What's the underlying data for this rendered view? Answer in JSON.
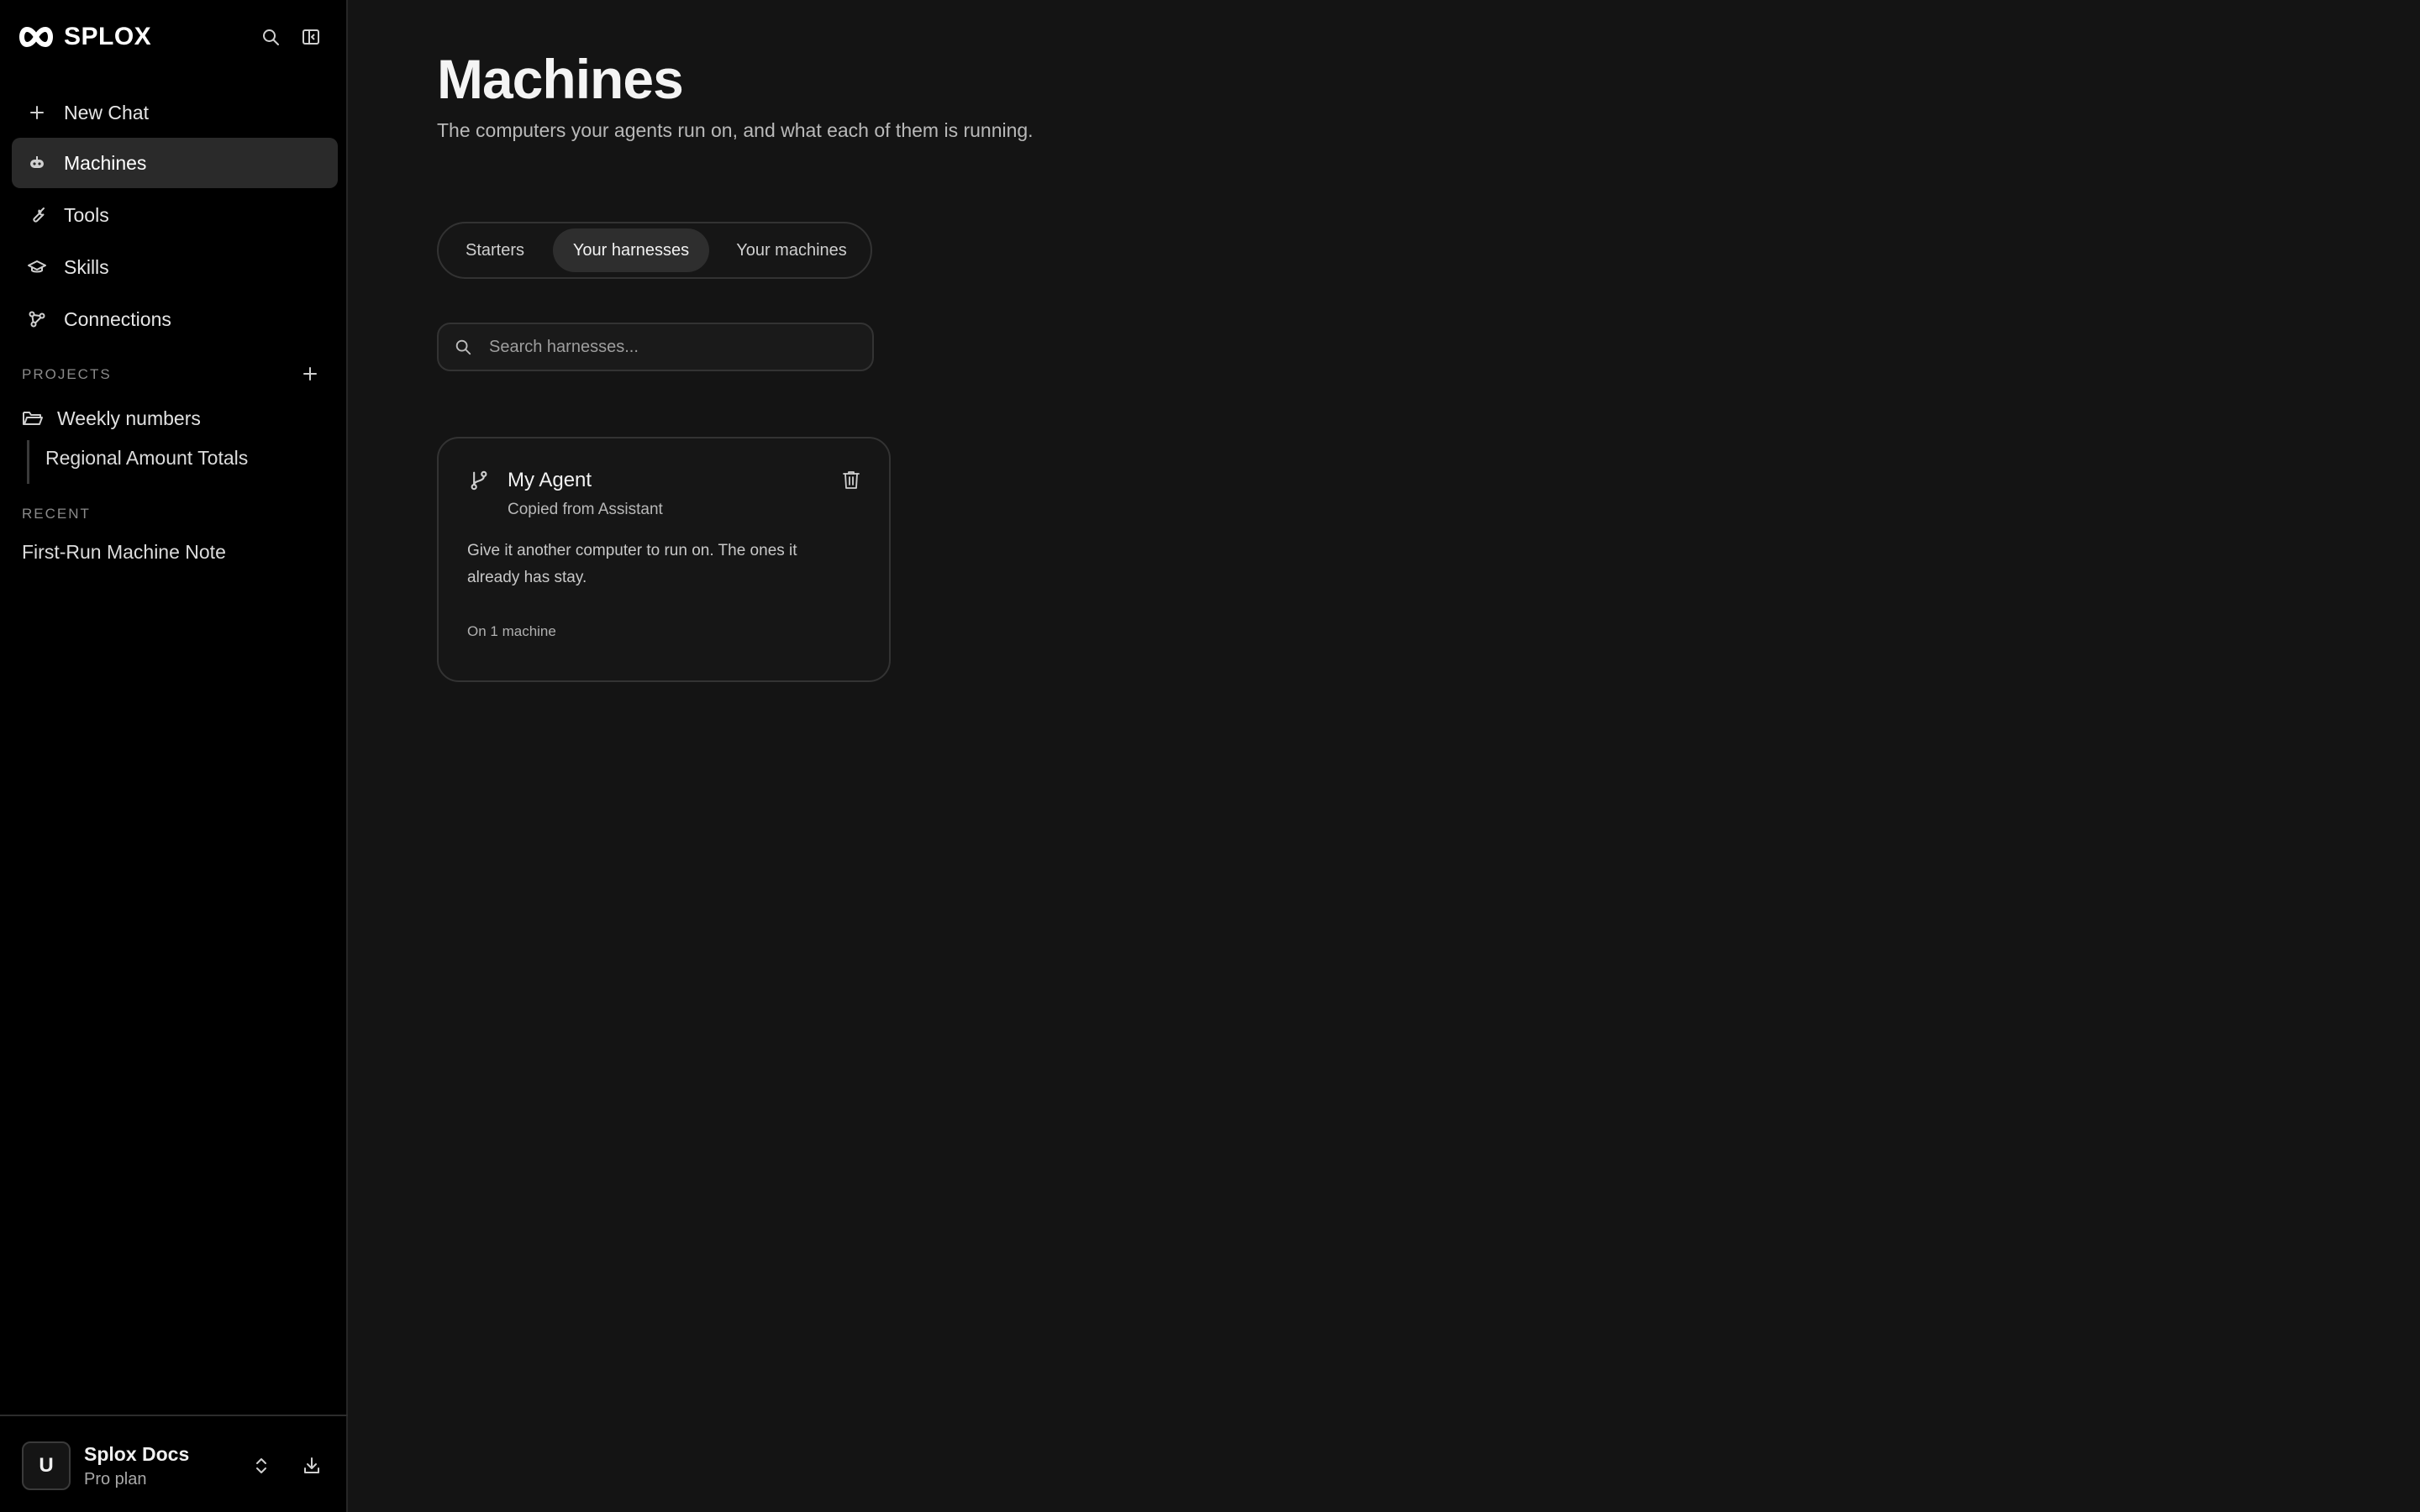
{
  "brand": {
    "name": "SPLOX",
    "logo_icon": "infinity-logo-icon"
  },
  "sidebar": {
    "nav": [
      {
        "label": "New Chat",
        "icon": "plus-icon",
        "active": false
      },
      {
        "label": "Machines",
        "icon": "robot-icon",
        "active": true
      },
      {
        "label": "Tools",
        "icon": "wrench-icon",
        "active": false
      },
      {
        "label": "Skills",
        "icon": "graduation-cap-icon",
        "active": false
      },
      {
        "label": "Connections",
        "icon": "connections-icon",
        "active": false
      }
    ],
    "projects_label": "PROJECTS",
    "projects": [
      {
        "label": "Weekly numbers",
        "children": [
          "Regional Amount Totals"
        ]
      }
    ],
    "recent_label": "RECENT",
    "recent": [
      "First-Run Machine Note"
    ],
    "account": {
      "initial": "U",
      "name": "Splox Docs",
      "plan": "Pro plan"
    }
  },
  "main": {
    "title": "Machines",
    "subtitle": "The computers your agents run on, and what each of them is running.",
    "tabs": [
      {
        "label": "Starters",
        "active": false
      },
      {
        "label": "Your harnesses",
        "active": true
      },
      {
        "label": "Your machines",
        "active": false
      }
    ],
    "search": {
      "placeholder": "Search harnesses...",
      "value": ""
    },
    "cards": [
      {
        "title": "My Agent",
        "subtitle": "Copied from Assistant",
        "description": "Give it another computer to run on. The ones it already has stay.",
        "meta": "On 1 machine",
        "icon": "git-branch-icon"
      }
    ]
  },
  "colors": {
    "sidebar_bg": "#000000",
    "main_bg": "#141414",
    "active_item_bg": "#2a2a2a",
    "border": "#333333",
    "text": "#e8e8e8",
    "muted_text": "#b9b9b9"
  }
}
